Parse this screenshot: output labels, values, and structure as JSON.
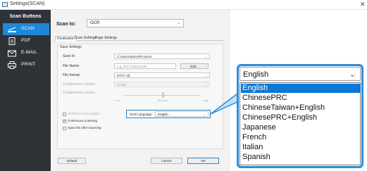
{
  "window": {
    "title": "Settings(SCAN)",
    "close_glyph": "✕"
  },
  "sidebar": {
    "title": "Scan Buttons",
    "items": [
      {
        "label": "SCAN",
        "icon": "scanner-icon",
        "active": true
      },
      {
        "label": "PDF",
        "icon": "pdf-icon",
        "active": false
      },
      {
        "label": "E-MAIL",
        "icon": "mail-icon",
        "active": false
      },
      {
        "label": "PRINT",
        "icon": "printer-icon",
        "active": false
      }
    ]
  },
  "main": {
    "scan_to_label": "Scan to:",
    "scan_to_value": "OCR",
    "tabs": [
      "Destination",
      "Scan Settings",
      "Page Settings"
    ],
    "section_title": "Save Settings",
    "save_in_label": "Save In:",
    "save_in_value": "C:\\Users\\admin\\Pictures\\",
    "file_name_label": "File Name:",
    "file_name_placeholder": "e.g.:20171108111158",
    "edit_button": "Edit...",
    "file_format_label": "File format:",
    "file_format_value": "RTF(*.rtf)",
    "compression_option_label": "Compression Option:",
    "compression_option_value": "NONE",
    "compression_levels_label": "Compression Levels:",
    "slider_low": "Low",
    "slider_medium": "Medium",
    "slider_high": "High",
    "ocr_text_label": "OCR(Text Searchable)",
    "continuous_label": "Continuous scanning",
    "open_file_label": "Open file after scanning",
    "ocr_language_label": "OCR Language",
    "ocr_language_value": "English",
    "default_button": "Default",
    "cancel_button": "Cancel",
    "ok_button": "OK"
  },
  "zoom_dropdown": {
    "selected": "English",
    "options": [
      "English",
      "ChinesePRC",
      "ChineseTaiwan+English",
      "ChinesePRC+English",
      "Japanese",
      "French",
      "Italian",
      "Spanish"
    ],
    "highlighted_index": 0
  },
  "colors": {
    "accent": "#1e88d8",
    "sidebar_bg": "#2e3338",
    "highlight": "#0a78d7"
  }
}
